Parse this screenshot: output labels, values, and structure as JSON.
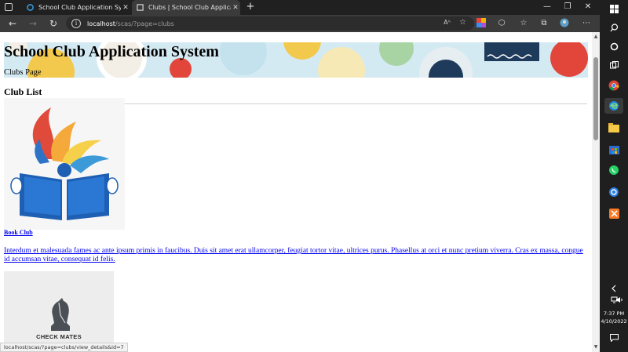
{
  "browser": {
    "tabs": [
      {
        "title": "School Club Application System"
      },
      {
        "title": "Clubs | School Club Application Sy"
      }
    ],
    "address": {
      "host": "localhost",
      "path": "/scas/?page=clubs"
    },
    "read_aloud_label": "Aᴬ",
    "status_url": "localhost/scas/?page=clubs/view_details&id=7"
  },
  "page": {
    "site_title": "School Club Application System",
    "site_subtitle": "Clubs Page",
    "section_heading": "Club List",
    "clubs": [
      {
        "name": "Book Club",
        "description": "Interdum et malesuada fames ac ante ipsum primis in faucibus. Duis sit amet erat ullamcorper, feugiat tortor vitae, ultrices purus. Phasellus at orci et nunc pretium viverra. Cras ex massa, congue id accumsan vitae, consequat id felis."
      },
      {
        "logo_text": "CHECK MATES"
      }
    ]
  },
  "taskbar": {
    "time": "7:37 PM",
    "date": "4/10/2022"
  },
  "colors": {
    "link": "#0000ee",
    "browser_chrome": "#3b3b3b",
    "taskbar": "#1f1f1f"
  }
}
